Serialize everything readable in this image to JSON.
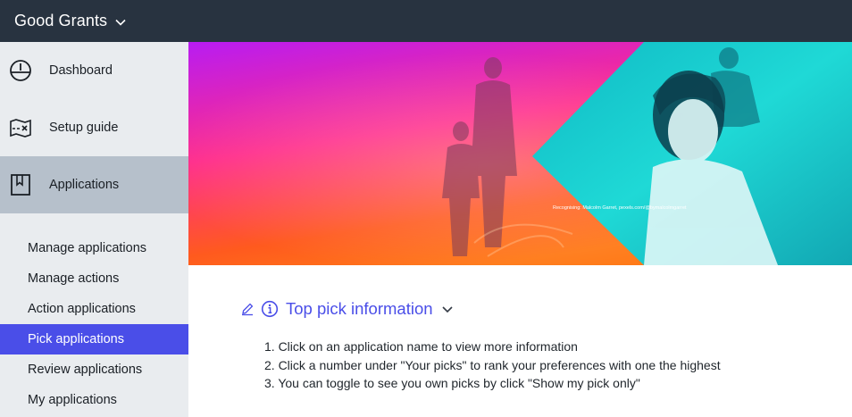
{
  "app": {
    "brand": "Good Grants"
  },
  "sidebar": {
    "items": [
      {
        "label": "Dashboard"
      },
      {
        "label": "Setup guide"
      },
      {
        "label": "Applications"
      }
    ],
    "subitems": [
      {
        "label": "Manage applications"
      },
      {
        "label": "Manage actions"
      },
      {
        "label": "Action applications"
      },
      {
        "label": "Pick applications"
      },
      {
        "label": "Review applications"
      },
      {
        "label": "My applications"
      }
    ],
    "active_item": "Applications",
    "active_subitem": "Pick applications"
  },
  "banner": {
    "credit": "Recognising: Malcolm Garret, pexels.com/@bymalcolmgarret"
  },
  "info": {
    "title": "Top pick information",
    "steps": [
      "1. Click on an application name to view more information",
      "2. Click a number under \"Your picks\" to rank your preferences with one the highest",
      "3. You can toggle to see you own picks by click \"Show my pick only\""
    ]
  },
  "colors": {
    "topbar": "#283340",
    "sidebar_bg": "#e9ecef",
    "sidebar_active": "#b6c0cb",
    "accent": "#4a4ee8",
    "banner_purple": "#c21cf0",
    "banner_orange": "#ff5a1e",
    "banner_cyan": "#1fd9d6"
  }
}
